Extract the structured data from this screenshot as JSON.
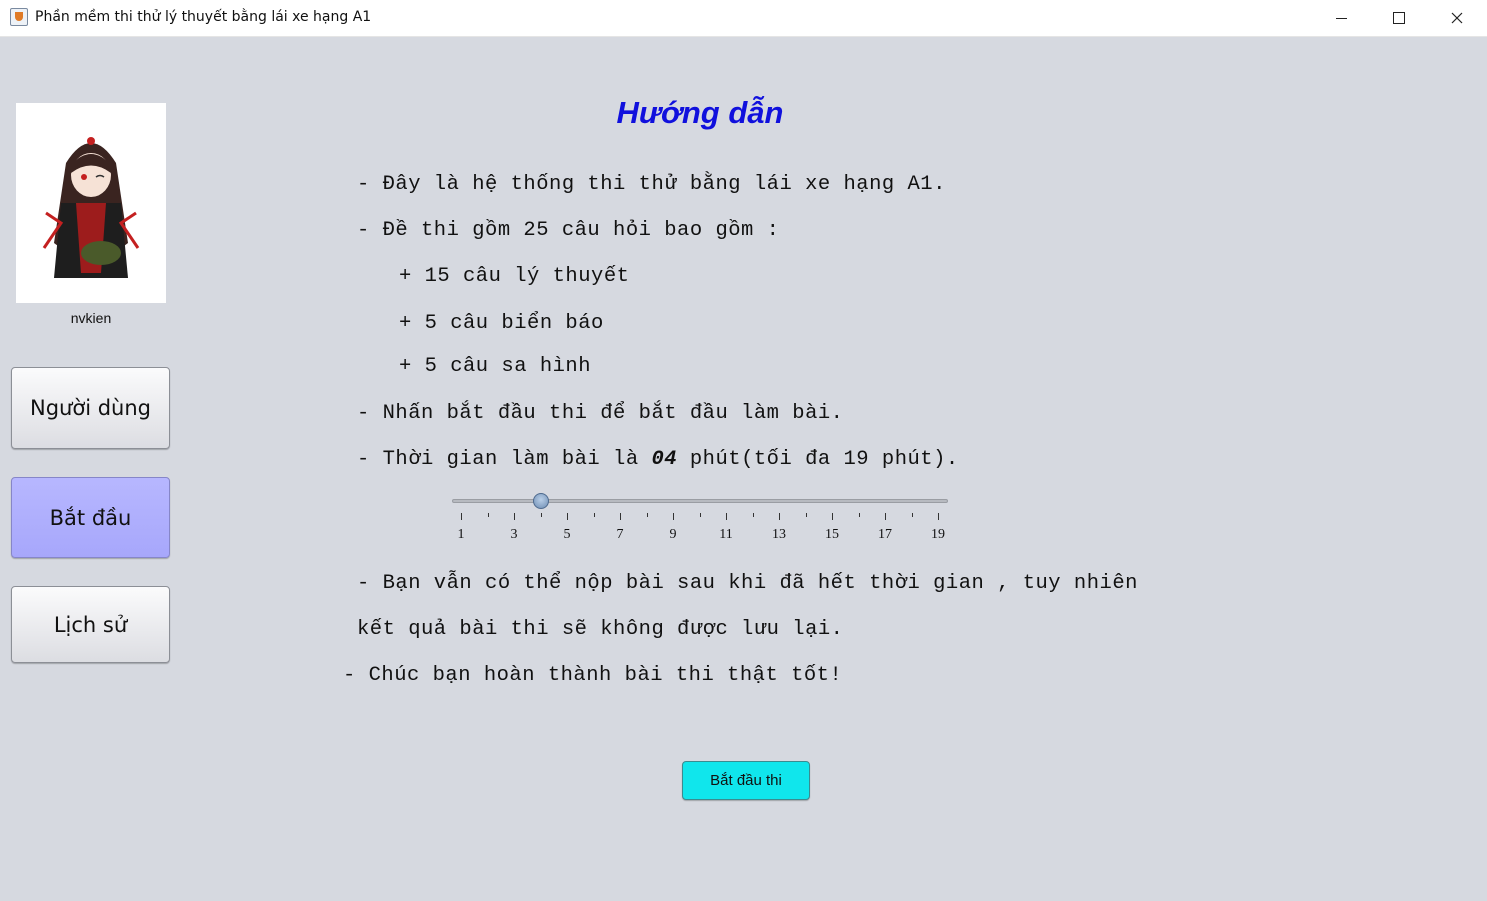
{
  "window": {
    "title": "Phần mềm thi thử lý thuyết bằng lái xe hạng A1",
    "controls": {
      "minimize": "minimize-icon",
      "maximize": "maximize-icon",
      "close": "close-icon"
    }
  },
  "sidebar": {
    "avatar": "anime-girl-avatar",
    "username": "nvkien",
    "buttons": [
      {
        "label": "Người dùng",
        "active": false
      },
      {
        "label": "Bắt đầu",
        "active": true
      },
      {
        "label": "Lịch sử",
        "active": false
      }
    ]
  },
  "guide": {
    "title": "Hướng dẫn",
    "line1": "- Đây là hệ thống thi thử bằng lái xe hạng A1.",
    "line2": "- Đề thi gồm 25 câu hỏi bao gồm :",
    "line3": "+ 15 câu lý thuyết",
    "line4": "+ 5 câu biển báo",
    "line5": "+ 5 câu sa hình",
    "line6": "- Nhấn bắt đầu thi để bắt đầu làm bài.",
    "time_prefix": "- Thời gian làm bài là ",
    "time_minutes": "04",
    "time_suffix": " phút(tối đa 19 phút).",
    "line8": "- Bạn vẫn có thể nộp bài sau khi đã hết thời gian , tuy nhiên",
    "line9": "kết quả bài thi sẽ không được lưu lại.",
    "line10": "- Chúc bạn hoàn thành bài thi thật tốt!"
  },
  "slider": {
    "min": 1,
    "max": 19,
    "value": 4,
    "tick_labels": [
      "1",
      "3",
      "5",
      "7",
      "9",
      "11",
      "13",
      "15",
      "17",
      "19"
    ]
  },
  "start_button": {
    "label": "Bắt đầu thi"
  },
  "colors": {
    "background": "#d6d9e0",
    "title": "#1010dd",
    "active_button": "#aeaefd",
    "start_exam_button": "#10e6ec"
  }
}
